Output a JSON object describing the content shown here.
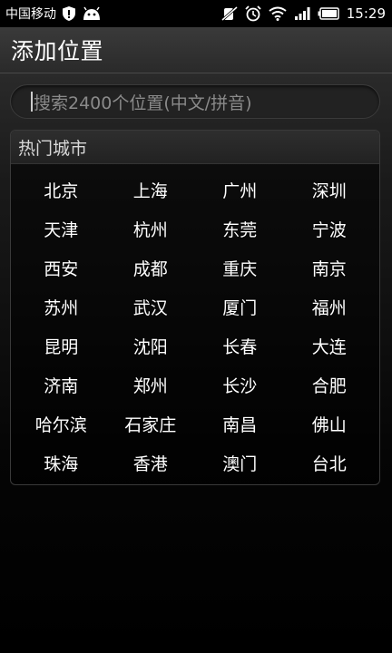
{
  "status_bar": {
    "carrier": "中国移动",
    "time": "15:29",
    "icons": [
      "shield-icon",
      "android-icon",
      "mute-icon",
      "alarm-icon",
      "wifi-icon",
      "signal-icon",
      "battery-icon"
    ]
  },
  "header": {
    "title": "添加位置"
  },
  "search": {
    "placeholder": "搜索2400个位置(中文/拼音)"
  },
  "hot_cities": {
    "title": "热门城市",
    "cities": [
      "北京",
      "上海",
      "广州",
      "深圳",
      "天津",
      "杭州",
      "东莞",
      "宁波",
      "西安",
      "成都",
      "重庆",
      "南京",
      "苏州",
      "武汉",
      "厦门",
      "福州",
      "昆明",
      "沈阳",
      "长春",
      "大连",
      "济南",
      "郑州",
      "长沙",
      "合肥",
      "哈尔滨",
      "石家庄",
      "南昌",
      "佛山",
      "珠海",
      "香港",
      "澳门",
      "台北"
    ]
  },
  "colors": {
    "background": "#000000",
    "titlebar": "#2f2f2f",
    "text": "#ffffff",
    "placeholder": "#8a8a8a"
  }
}
